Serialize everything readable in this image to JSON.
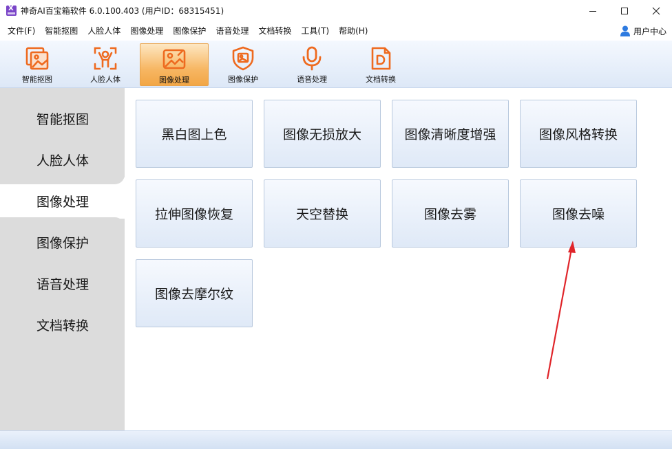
{
  "window": {
    "title": "神奇AI百宝箱软件 6.0.100.403 (用户ID：68315451)"
  },
  "menu": {
    "items": [
      "文件(F)",
      "智能抠图",
      "人脸人体",
      "图像处理",
      "图像保护",
      "语音处理",
      "文档转换",
      "工具(T)",
      "帮助(H)"
    ],
    "user_center": "用户中心"
  },
  "toolbar": {
    "items": [
      {
        "label": "智能抠图",
        "icon": "image-cutout-icon"
      },
      {
        "label": "人脸人体",
        "icon": "face-body-icon"
      },
      {
        "label": "图像处理",
        "icon": "image-edit-icon"
      },
      {
        "label": "图像保护",
        "icon": "image-shield-icon"
      },
      {
        "label": "语音处理",
        "icon": "microphone-icon"
      },
      {
        "label": "文档转换",
        "icon": "document-icon"
      }
    ],
    "active_index": 2,
    "accent_color": "#ee6a1f"
  },
  "sidebar": {
    "items": [
      "智能抠图",
      "人脸人体",
      "图像处理",
      "图像保护",
      "语音处理",
      "文档转换"
    ],
    "active_index": 2
  },
  "features": [
    "黑白图上色",
    "图像无损放大",
    "图像清晰度增强",
    "图像风格转换",
    "拉伸图像恢复",
    "天空替换",
    "图像去雾",
    "图像去噪",
    "图像去摩尔纹"
  ]
}
